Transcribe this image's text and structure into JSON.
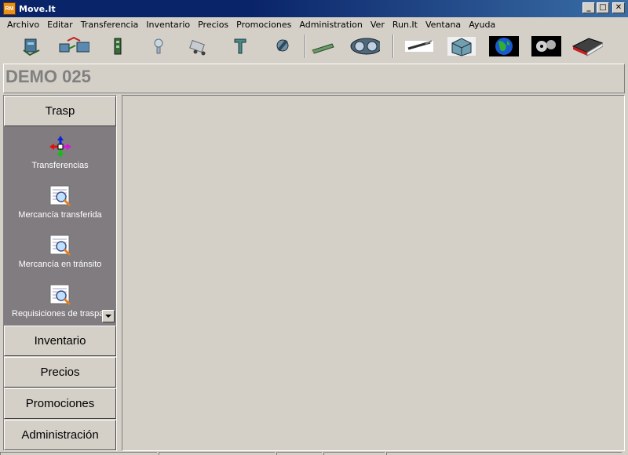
{
  "window": {
    "title": "Move.It",
    "icon_label": "RM",
    "controls": {
      "minimize": "_",
      "maximize": "□",
      "close": "✕"
    }
  },
  "menu": [
    "Archivo",
    "Editar",
    "Transferencia",
    "Inventario",
    "Precios",
    "Promociones",
    "Administration",
    "Ver",
    "Run.It",
    "Ventana",
    "Ayuda"
  ],
  "toolbar": [
    {
      "icon": "transfer-tool-icon"
    },
    {
      "icon": "shipment-tool-icon"
    },
    {
      "icon": "inventory-tool-icon"
    },
    {
      "icon": "pricing-tool-icon"
    },
    {
      "icon": "truck-tool-icon"
    },
    {
      "icon": "store-tool-icon"
    },
    {
      "icon": "tools-icon"
    },
    {
      "icon": "pencil-tool-icon"
    },
    {
      "icon": "cd-tool-icon"
    },
    {
      "icon": "brush-tool-icon"
    },
    {
      "icon": "cube-tool-icon"
    },
    {
      "icon": "globe-icon"
    },
    {
      "icon": "parts-tool-icon"
    },
    {
      "icon": "book-icon"
    }
  ],
  "header": {
    "title": "DEMO 025"
  },
  "leftpanel": {
    "groups": [
      "Trasp",
      "Inventario",
      "Precios",
      "Promociones",
      "Administración"
    ],
    "items": [
      {
        "label": "Transferencias",
        "icon": "move-arrows-icon"
      },
      {
        "label": "Mercancía transferida",
        "icon": "report-search-icon"
      },
      {
        "label": "Mercancía en tránsito",
        "icon": "report-search-icon"
      },
      {
        "label": "Requisiciones de traspaso",
        "icon": "report-search-icon"
      }
    ]
  },
  "colors": {
    "title_bar": "#0a246a",
    "pane_bg": "#807c80",
    "header_text": "#808080",
    "window_bg": "#d4d0c8"
  }
}
